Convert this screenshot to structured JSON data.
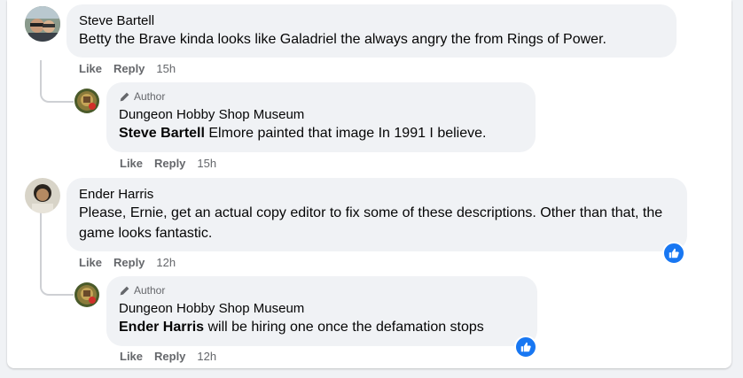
{
  "comments": [
    {
      "author": "Steve Bartell",
      "text": "Betty the Brave kinda looks like Galadriel the always angry the from Rings of Power.",
      "like": "Like",
      "reply": "Reply",
      "time": "15h",
      "reply_comment": {
        "badge": "Author",
        "author": "Dungeon Hobby Shop Museum",
        "mention": "Steve Bartell",
        "text": " Elmore painted that image In 1991 I believe.",
        "like": "Like",
        "reply": "Reply",
        "time": "15h"
      }
    },
    {
      "author": "Ender Harris",
      "text": "Please, Ernie, get an actual copy editor to fix some of these descriptions. Other than that, the game looks fantastic.",
      "like": "Like",
      "reply": "Reply",
      "time": "12h",
      "reaction_icon": "like-icon",
      "reply_comment": {
        "badge": "Author",
        "author": "Dungeon Hobby Shop Museum",
        "mention": "Ender Harris",
        "text": " will be hiring one once the defamation stops",
        "like": "Like",
        "reply": "Reply",
        "time": "12h",
        "reaction_icon": "like-icon"
      }
    }
  ],
  "colors": {
    "bubble": "#f0f2f5",
    "meta_text": "#65676b",
    "reaction_blue": "#1877f2",
    "thread_line": "#ced0d4"
  }
}
